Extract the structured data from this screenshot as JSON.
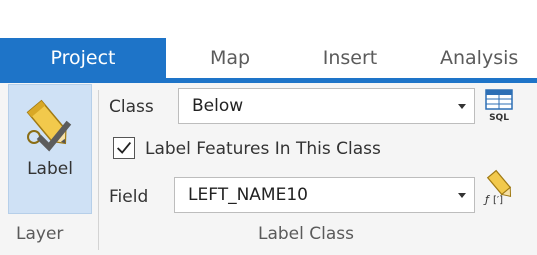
{
  "tabs": [
    {
      "label": "Project",
      "active": true
    },
    {
      "label": "Map",
      "active": false
    },
    {
      "label": "Insert",
      "active": false
    },
    {
      "label": "Analysis",
      "active": false
    }
  ],
  "layer_group": {
    "label_button": "Label",
    "group_label": "Layer"
  },
  "label_class_group": {
    "class_label": "Class",
    "class_value": "Below",
    "checkbox_label": "Label Features In This Class",
    "checkbox_checked": true,
    "field_label": "Field",
    "field_value": "LEFT_NAME10",
    "sql_icon_text": "SQL",
    "group_label": "Label Class"
  },
  "colors": {
    "accent": "#1e74c8",
    "selected_button": "#cfe1f5",
    "ribbon_bg": "#f5f5f5"
  },
  "icons": [
    "label-pencil-check-icon",
    "sql-query-icon",
    "label-expression-icon",
    "chevron-down-icon",
    "checkmark-icon"
  ]
}
